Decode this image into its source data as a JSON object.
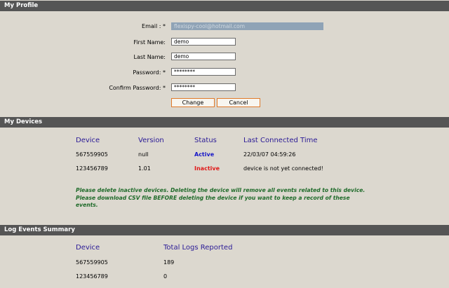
{
  "profile": {
    "header": "My Profile",
    "email_label": "Email : *",
    "email_value": "flexispy-cool@hotmail.com",
    "first_name_label": "First Name:",
    "first_name_value": "demo",
    "last_name_label": "Last Name:",
    "last_name_value": "demo",
    "password_label": "Password: *",
    "password_value": "********",
    "confirm_password_label": "Confirm Password: *",
    "confirm_password_value": "********",
    "change_button": "Change",
    "cancel_button": "Cancel"
  },
  "devices": {
    "header": "My Devices",
    "columns": [
      "Device",
      "Version",
      "Status",
      "Last Connected Time"
    ],
    "rows": [
      {
        "device": "567559905",
        "version": "null",
        "status": "Active",
        "last_connected": "22/03/07 04:59:26"
      },
      {
        "device": "123456789",
        "version": "1.01",
        "status": "Inactive",
        "last_connected": "device is not yet connected!"
      }
    ],
    "notice_line1": "Please delete inactive devices. Deleting the device will remove all events related to this device.",
    "notice_line2": "Please download CSV file BEFORE deleting the device if you want to keep a record of these",
    "notice_line3": "events."
  },
  "log_summary": {
    "header": "Log Events Summary",
    "columns": [
      "Device",
      "Total Logs Reported"
    ],
    "rows": [
      {
        "device": "567559905",
        "total": "189"
      },
      {
        "device": "123456789",
        "total": "0"
      }
    ]
  },
  "colors": {
    "header_bar": "#555555",
    "column_header": "#2a1a96",
    "active": "#1616c8",
    "inactive": "#e01818",
    "notice": "#1f6b2a",
    "button_border": "#e07a2a"
  }
}
